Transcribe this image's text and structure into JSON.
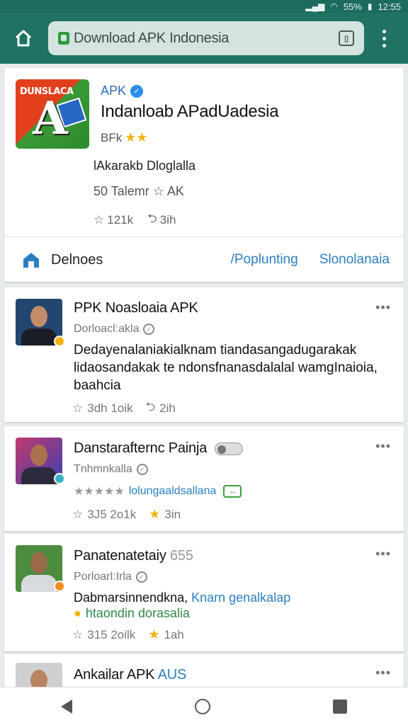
{
  "status": {
    "battery_pct": "55%",
    "time": "12:55"
  },
  "toolbar": {
    "url": "Download APK Indonesia"
  },
  "app": {
    "icon_text": "DUNSLACA",
    "publisher_tag": "APK",
    "title": "Indanloab APadUadesia",
    "rating_label": "BFk",
    "developer": "lAkarakb Dloglalla",
    "size_line": "50 Talemr",
    "size_suffix": "AK",
    "likes": "121k",
    "shares": "3ih",
    "action_label": "Delnoes",
    "action_link1": "/Poplunting",
    "action_link2": "Slonolanaia"
  },
  "posts": [
    {
      "title": "PPK Noasloaia APK",
      "sub": "Dorloacl:akla",
      "body": "Dedayenalaniakialknam tiandasangadugarakak lidaosandakak te ndonsfnanasdalalal wamgInaioia, baahcia",
      "meta1": "3dh 1oik",
      "meta2": "2ih"
    },
    {
      "title": "Danstarafternc Painja",
      "sub": "Tnhmnkalla",
      "extra": "lolungaaldsallana",
      "meta1": "3J5 2o1k",
      "meta2": "3in"
    },
    {
      "title": "Panatenatetaiy",
      "title_suffix": "655",
      "sub": "Porloarl:Irla",
      "body_a": "Dabmarsinnendkna, ",
      "body_b": "Knarn genalkalap",
      "body2": "htaondin dorasalia",
      "meta1": "315 2oilk",
      "meta2": "1ah"
    },
    {
      "title": "Ankailar APK ",
      "title_suffix": "AUS"
    }
  ],
  "colors": {
    "toolbar": "#1e7363",
    "link": "#2c7fbf",
    "star": "#f1b40b"
  }
}
